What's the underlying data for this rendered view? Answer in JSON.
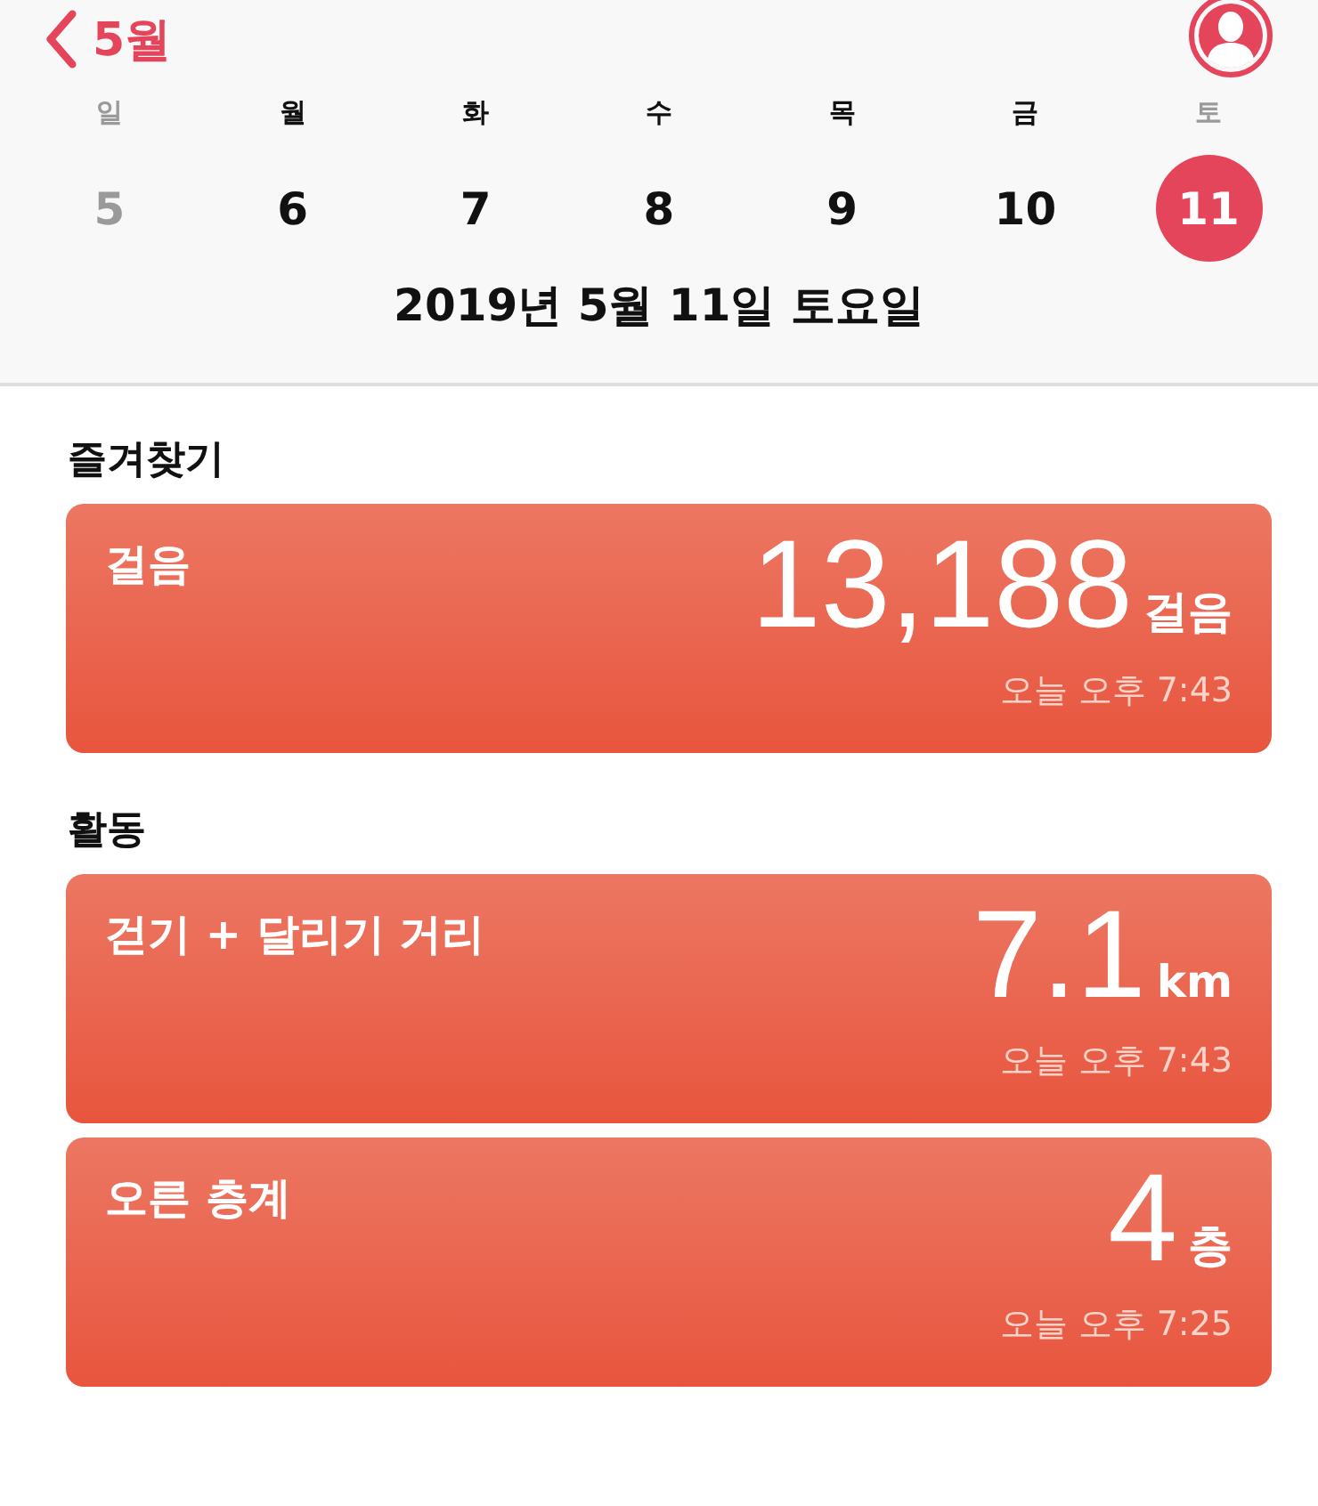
{
  "nav": {
    "back_label": "5월"
  },
  "week": [
    {
      "weekday": "일",
      "date": "5",
      "weekend": true,
      "selected": false
    },
    {
      "weekday": "월",
      "date": "6",
      "weekend": false,
      "selected": false
    },
    {
      "weekday": "화",
      "date": "7",
      "weekend": false,
      "selected": false
    },
    {
      "weekday": "수",
      "date": "8",
      "weekend": false,
      "selected": false
    },
    {
      "weekday": "목",
      "date": "9",
      "weekend": false,
      "selected": false
    },
    {
      "weekday": "금",
      "date": "10",
      "weekend": false,
      "selected": false
    },
    {
      "weekday": "토",
      "date": "11",
      "weekend": true,
      "selected": true
    }
  ],
  "date_title": "2019년 5월 11일 토요일",
  "sections": [
    {
      "title": "즐겨찾기",
      "cards": [
        {
          "label": "걸음",
          "value": "13,188",
          "unit": "걸음",
          "time": "오늘 오후 7:43"
        }
      ]
    },
    {
      "title": "활동",
      "cards": [
        {
          "label": "걷기 + 달리기 거리",
          "value": "7.1",
          "unit": "km",
          "time": "오늘 오후 7:43"
        },
        {
          "label": "오른 층계",
          "value": "4",
          "unit": "층",
          "time": "오늘 오후 7:25"
        }
      ]
    }
  ]
}
